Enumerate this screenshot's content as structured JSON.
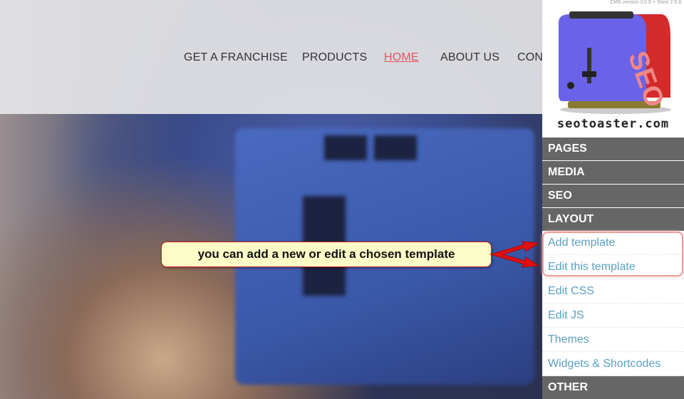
{
  "header": {
    "nav": [
      {
        "label": "GET A FRANCHISE"
      },
      {
        "label": "PRODUCTS"
      },
      {
        "label": "HOME",
        "active": true
      },
      {
        "label": "ABOUT US"
      },
      {
        "label": "CON"
      }
    ]
  },
  "sidebar": {
    "version": "CMS version 3.0.9 + Store 2.6.8",
    "logo_text": "SEO",
    "site_name": "seotoaster.com",
    "sections": [
      "PAGES",
      "MEDIA",
      "SEO",
      "LAYOUT"
    ],
    "layout_items": [
      "Add template",
      "Edit this template",
      "Edit CSS",
      "Edit JS",
      "Themes",
      "Widgets & Shortcodes"
    ],
    "other": "OTHER"
  },
  "callout": {
    "text": "you can add a new or edit a chosen template"
  },
  "colors": {
    "accent": "#e05560",
    "section_bg": "#666666",
    "link": "#5b9fc3",
    "callout_bg": "#fdfdc8",
    "arrow": "#e01010"
  }
}
